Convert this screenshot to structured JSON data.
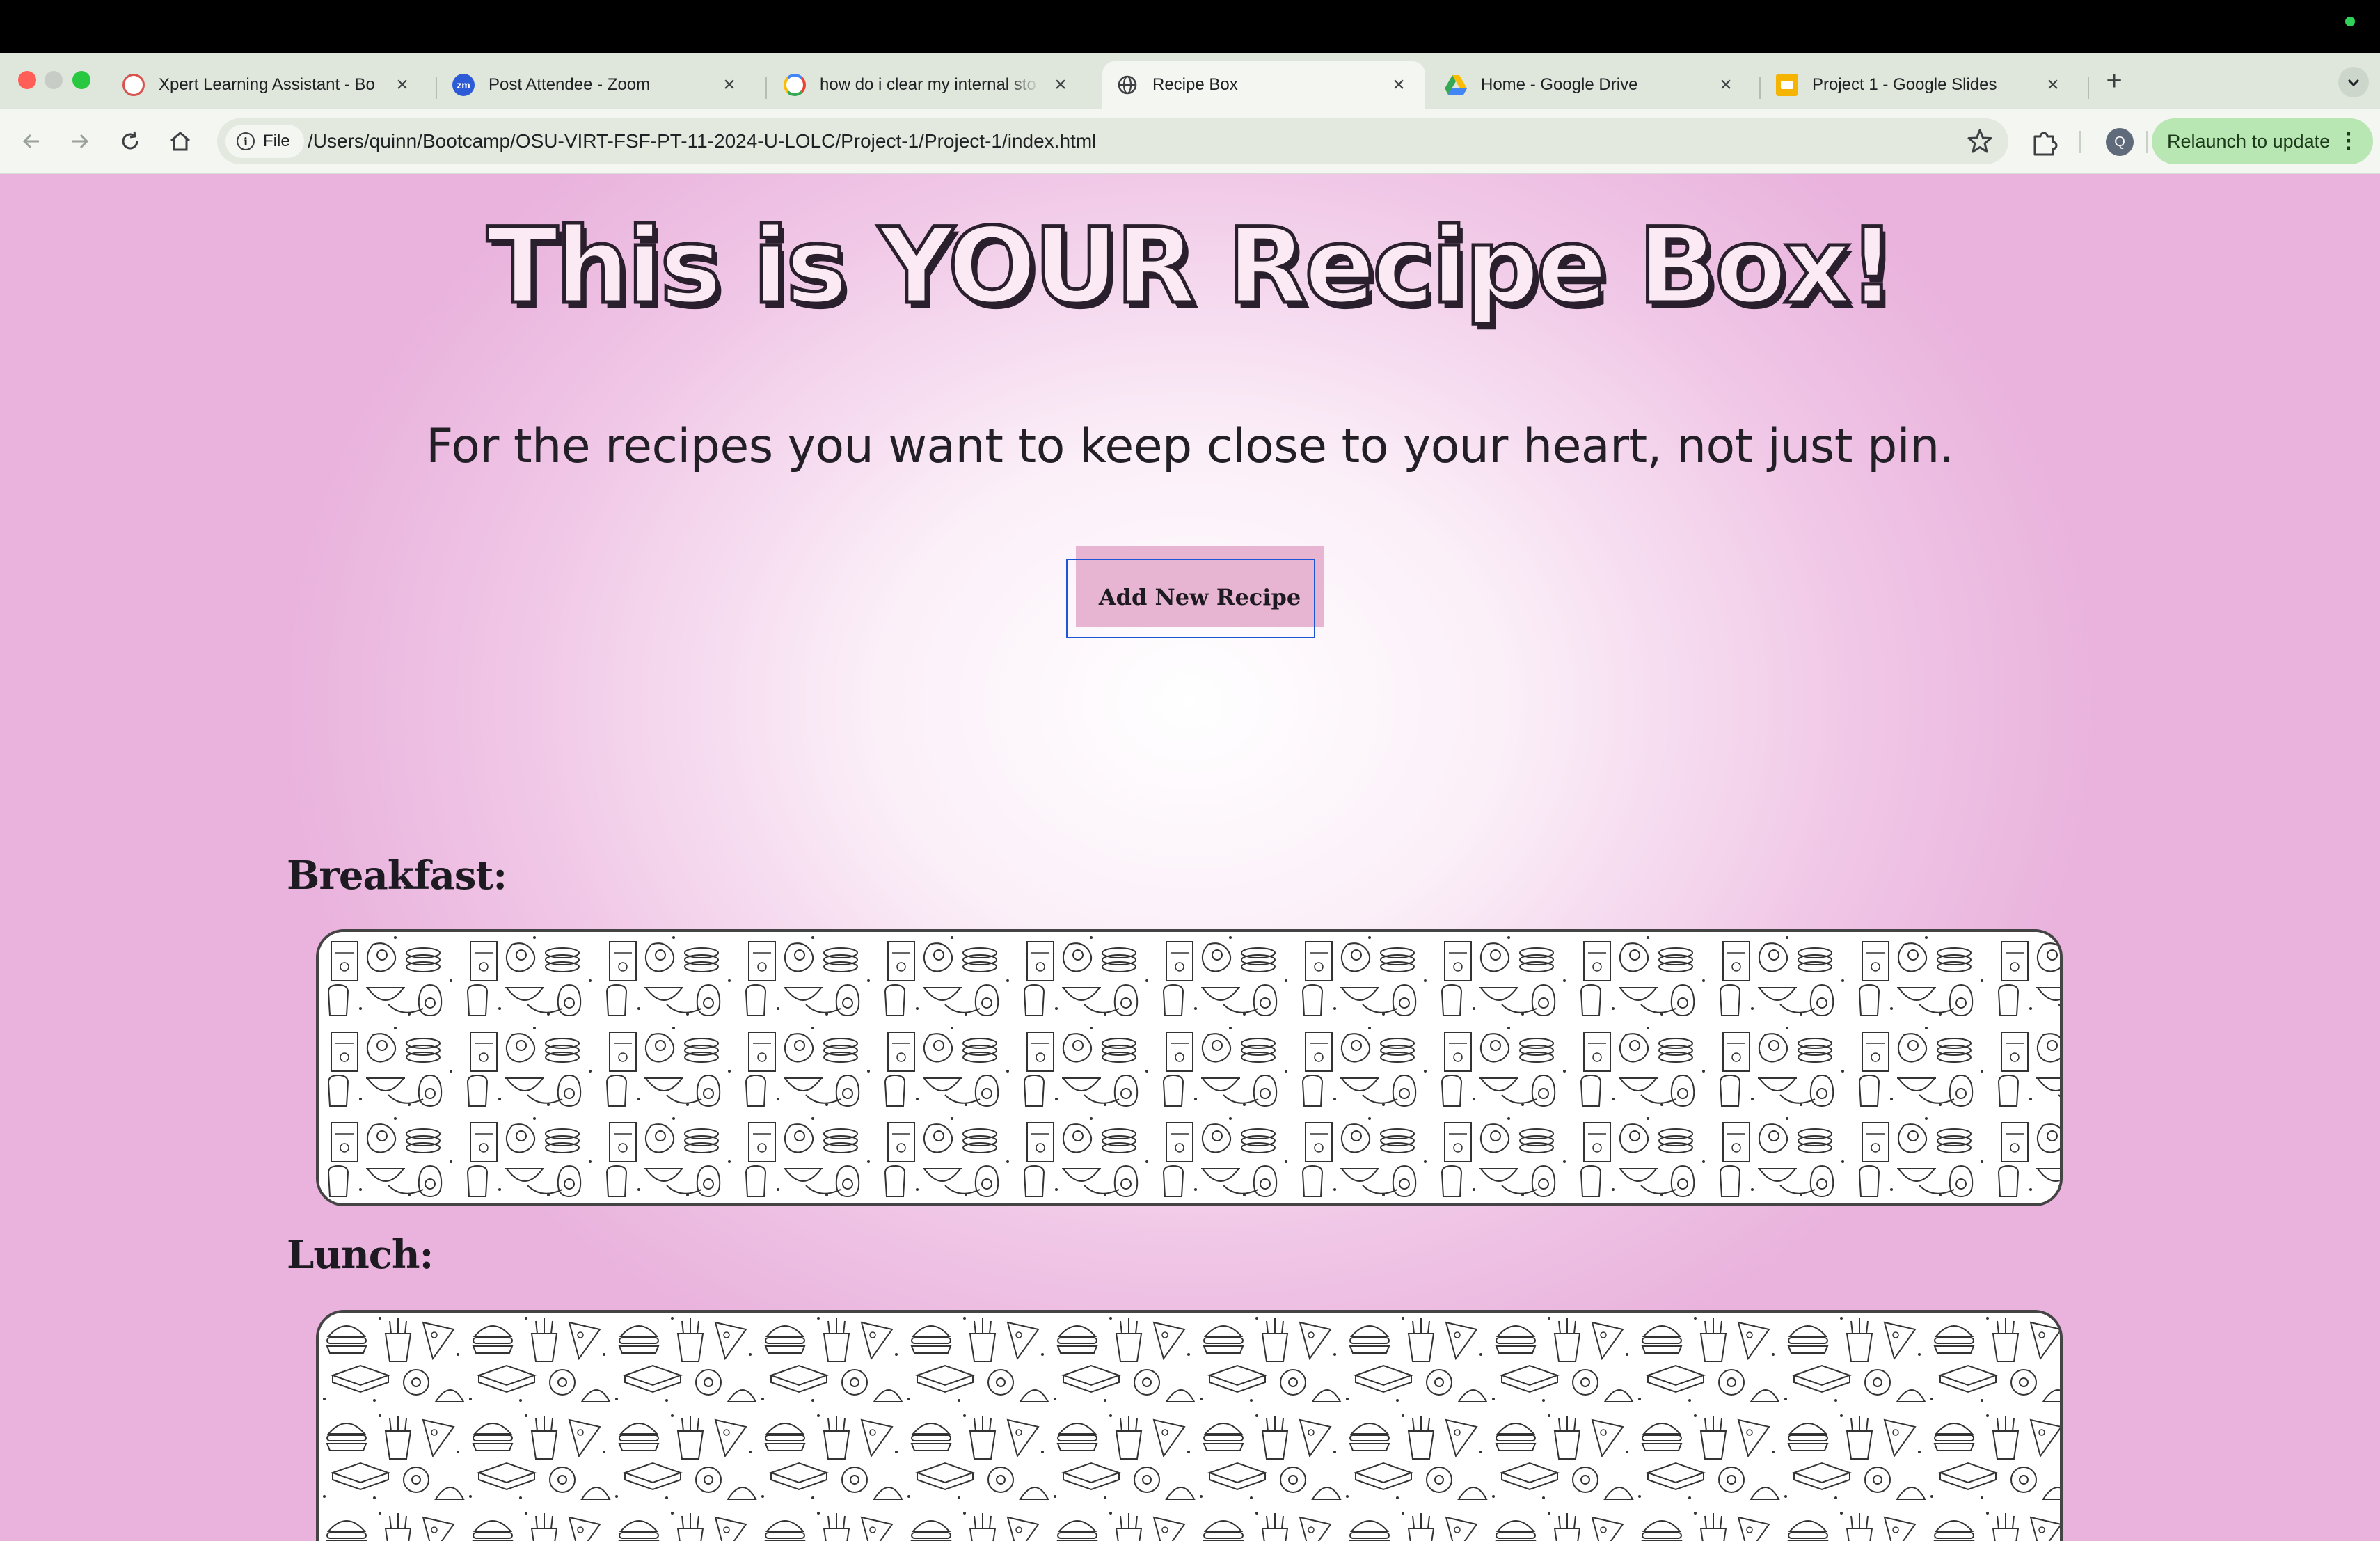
{
  "browser": {
    "tabs": [
      {
        "label": "Xpert Learning Assistant - Bo",
        "favicon": "xpert-icon",
        "active": false
      },
      {
        "label": "Post Attendee - Zoom",
        "favicon": "zoom-icon",
        "active": false
      },
      {
        "label": "how do i clear my internal sto",
        "favicon": "google-icon",
        "active": false
      },
      {
        "label": "Recipe Box",
        "favicon": "globe-icon",
        "active": true
      },
      {
        "label": "Home - Google Drive",
        "favicon": "google-drive-icon",
        "active": false
      },
      {
        "label": "Project 1 - Google Slides",
        "favicon": "google-slides-icon",
        "active": false
      }
    ],
    "zoom_favicon_text": "zm",
    "address_chip": "File",
    "url": "/Users/quinn/Bootcamp/OSU-VIRT-FSF-PT-11-2024-U-LOLC/Project-1/Project-1/index.html",
    "profile_initial": "Q",
    "relaunch_label": "Relaunch to update"
  },
  "page": {
    "title": "This is YOUR Recipe Box!",
    "subtitle": "For the recipes you want to keep close to your heart, not just pin.",
    "add_button": "Add New Recipe",
    "categories": [
      {
        "label": "Breakfast:",
        "pattern": "breakfast-doodle-pattern"
      },
      {
        "label": "Lunch:",
        "pattern": "lunch-doodle-pattern"
      }
    ]
  },
  "colors": {
    "page_gradient_center": "#ffffff",
    "page_gradient_edge": "#e9b3dd",
    "add_button_bg": "#e7b5d2",
    "focus_ring": "#1a56d6",
    "relaunch_bg": "#b9e7b3"
  }
}
